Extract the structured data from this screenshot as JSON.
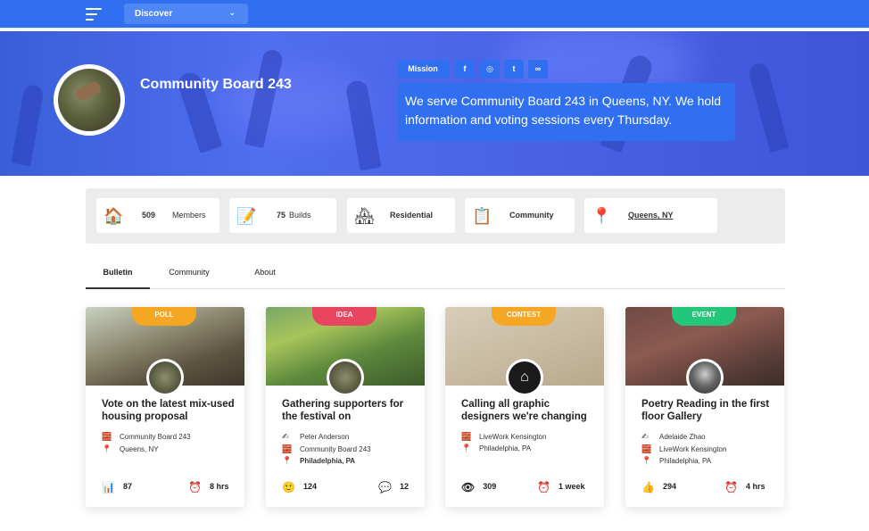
{
  "topbar": {
    "menu_icon": "hamburger-menu-icon",
    "dropdown_label": "Discover",
    "dropdown_icon": "chevron-down-icon"
  },
  "profile": {
    "name": "Community Board 243",
    "mission_label": "Mission",
    "social": [
      {
        "icon": "facebook-icon",
        "glyph": "f"
      },
      {
        "icon": "instagram-icon",
        "glyph": "◎"
      },
      {
        "icon": "twitter-icon",
        "glyph": "t"
      },
      {
        "icon": "link-icon",
        "glyph": "∞"
      }
    ],
    "mission_text": "We serve Community Board 243 in Queens, NY. We hold information and voting sessions every Thursday."
  },
  "stats": [
    {
      "icon": "house-icon",
      "glyph": "🏠",
      "number": "509",
      "label": "Members"
    },
    {
      "icon": "memo-icon",
      "glyph": "📝",
      "number": "75",
      "label": "Builds"
    },
    {
      "icon": "houses-icon",
      "glyph": "🏘",
      "number": "",
      "label": "Residential"
    },
    {
      "icon": "clipboard-icon",
      "glyph": "📋",
      "number": "",
      "label": "Community"
    },
    {
      "icon": "pin-icon",
      "glyph": "📍",
      "number": "",
      "label": "Queens, NY"
    }
  ],
  "tabs": [
    "Bulletin",
    "Community",
    "About"
  ],
  "cards": [
    {
      "tag": "POLL",
      "tag_color": "#f5a623",
      "title": "Vote on the latest mix-used housing proposal",
      "rows": [
        {
          "icon": "brick-icon",
          "glyph": "🧱",
          "text": "Community Board 243",
          "bold": false
        },
        {
          "icon": "pin-icon",
          "glyph": "📍",
          "text": "Queens, NY",
          "bold": false
        }
      ],
      "left_icon": "chart-icon",
      "left_glyph": "📊",
      "left_value": "87",
      "right_icon": "alarm-clock-icon",
      "right_glyph": "⏰",
      "right_value": "8 hrs"
    },
    {
      "tag": "IDEA",
      "tag_color": "#e8455f",
      "title": "Gathering supporters for the festival on",
      "rows": [
        {
          "icon": "pencil-icon",
          "glyph": "✍",
          "text": "Peter Anderson",
          "bold": false
        },
        {
          "icon": "brick-icon",
          "glyph": "🧱",
          "text": "Community Board 243",
          "bold": false
        },
        {
          "icon": "pin-icon",
          "glyph": "📍",
          "text": "Philadelphia, PA",
          "bold": true
        }
      ],
      "left_icon": "smile-icon",
      "left_glyph": "🙂",
      "left_value": "124",
      "right_icon": "speech-bubble-icon",
      "right_glyph": "💬",
      "right_value": "12"
    },
    {
      "tag": "CONTEST",
      "tag_color": "#f5a623",
      "title": "Calling all graphic designers we're changing",
      "rows": [
        {
          "icon": "brick-icon",
          "glyph": "🧱",
          "text": "LiveWork Kensington",
          "bold": false
        },
        {
          "icon": "pin-icon",
          "glyph": "📍",
          "text": "Philadelphia, PA",
          "bold": false
        }
      ],
      "left_icon": "eye-icon",
      "left_glyph": "👁",
      "left_value": "309",
      "right_icon": "alarm-clock-icon",
      "right_glyph": "⏰",
      "right_value": "1 week"
    },
    {
      "tag": "EVENT",
      "tag_color": "#22c77a",
      "title": "Poetry Reading in the first floor Gallery",
      "rows": [
        {
          "icon": "pencil-icon",
          "glyph": "✍",
          "text": "Adelaide Zhao",
          "bold": false
        },
        {
          "icon": "brick-icon",
          "glyph": "🧱",
          "text": "LiveWork Kensington",
          "bold": false
        },
        {
          "icon": "pin-icon",
          "glyph": "📍",
          "text": "Philadelphia, PA",
          "bold": false
        }
      ],
      "left_icon": "thumbs-up-icon",
      "left_glyph": "👍",
      "left_value": "294",
      "right_icon": "alarm-clock-icon",
      "right_glyph": "⏰",
      "right_value": "4 hrs"
    }
  ]
}
